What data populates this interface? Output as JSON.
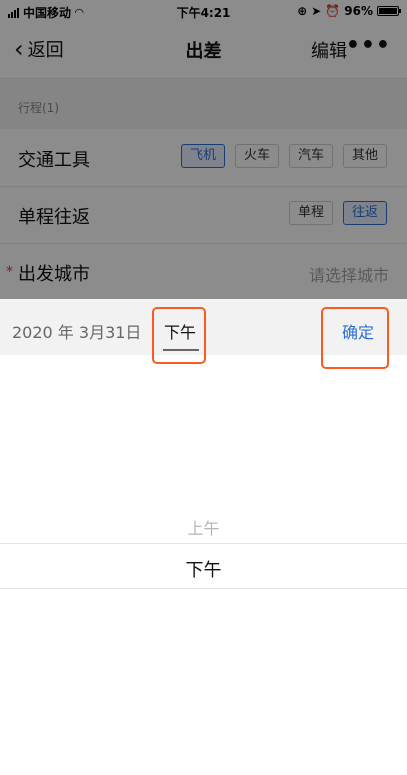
{
  "status_bar": {
    "carrier": "中国移动",
    "time": "下午4:21",
    "battery": "96%",
    "battery_level": 0.96
  },
  "nav": {
    "back_label": "返回",
    "title": "出差",
    "edit_label": "编辑",
    "more_label": "•••"
  },
  "section": {
    "label": "行程(1)"
  },
  "rows": {
    "transport": {
      "label": "交通工具",
      "options": [
        "飞机",
        "火车",
        "汽车",
        "其他"
      ],
      "selected": "飞机"
    },
    "trip_type": {
      "label": "单程往返",
      "options": [
        "单程",
        "往返"
      ],
      "selected": "往返"
    },
    "departure": {
      "required_mark": "*",
      "label": "出发城市",
      "placeholder": "请选择城市"
    }
  },
  "picker": {
    "date_text": "2020 年 3月31日",
    "tab_label": "下午",
    "confirm_label": "确定",
    "options": [
      "上午",
      "下午"
    ],
    "selected": "下午"
  },
  "colors": {
    "accent": "#2b6fd6",
    "highlight": "#ff5a1f",
    "required": "#dd3333"
  }
}
